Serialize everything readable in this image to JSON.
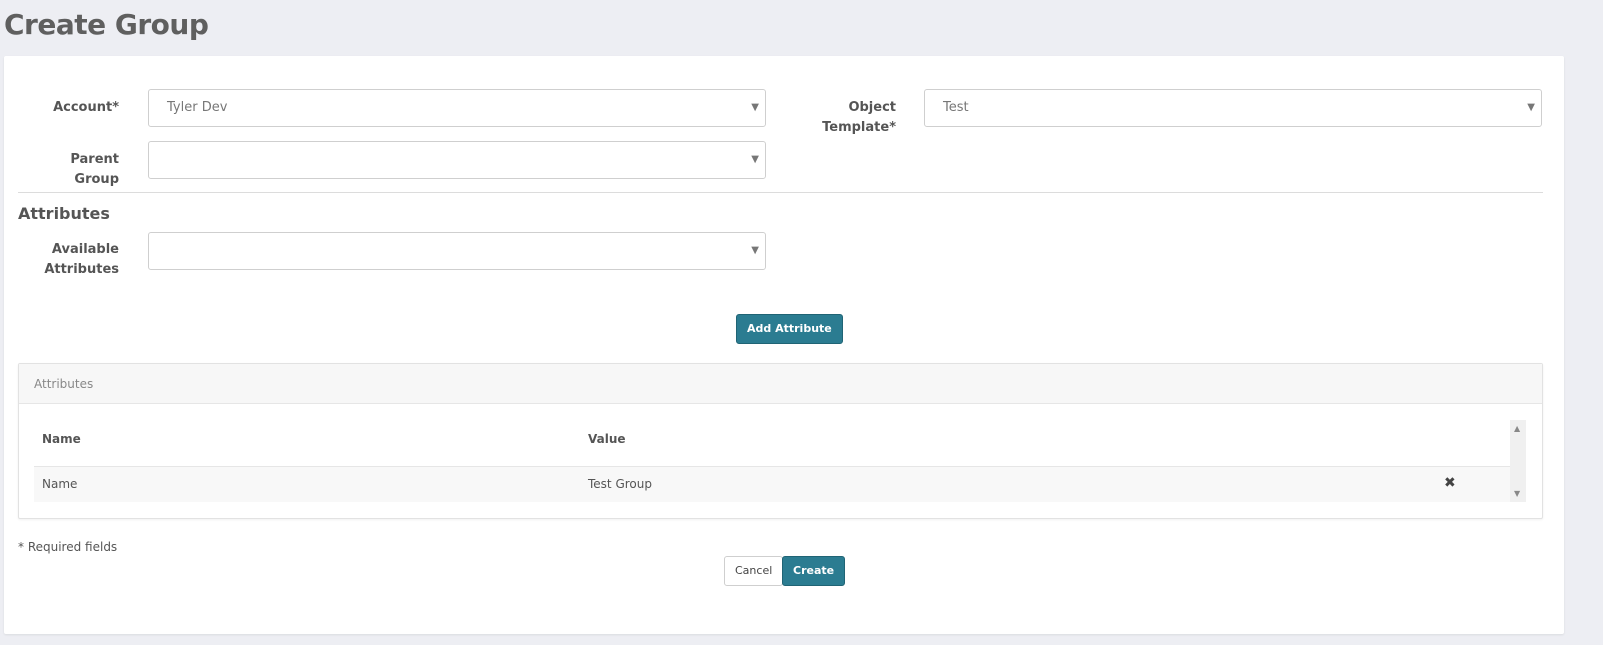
{
  "page": {
    "title": "Create Group"
  },
  "form": {
    "account": {
      "label": "Account*",
      "value": "Tyler Dev"
    },
    "object_template": {
      "label": "Object Template*",
      "value": "Test"
    },
    "parent_group": {
      "label": "Parent Group",
      "value": ""
    },
    "section_title": "Attributes",
    "available_attributes": {
      "label_line1": "Available",
      "label_line2": "Attributes",
      "value": ""
    },
    "add_attribute_label": "Add Attribute"
  },
  "attributes_panel": {
    "title": "Attributes",
    "columns": [
      "Name",
      "Value"
    ],
    "rows": [
      {
        "name": "Name",
        "value": "Test Group"
      }
    ]
  },
  "footer": {
    "required_note": "* Required fields",
    "cancel_label": "Cancel",
    "create_label": "Create"
  },
  "icons": {
    "caret": "caret-down-icon",
    "remove": "remove-x-icon"
  },
  "colors": {
    "primary": "#2b7c91",
    "background": "#edeef3"
  }
}
